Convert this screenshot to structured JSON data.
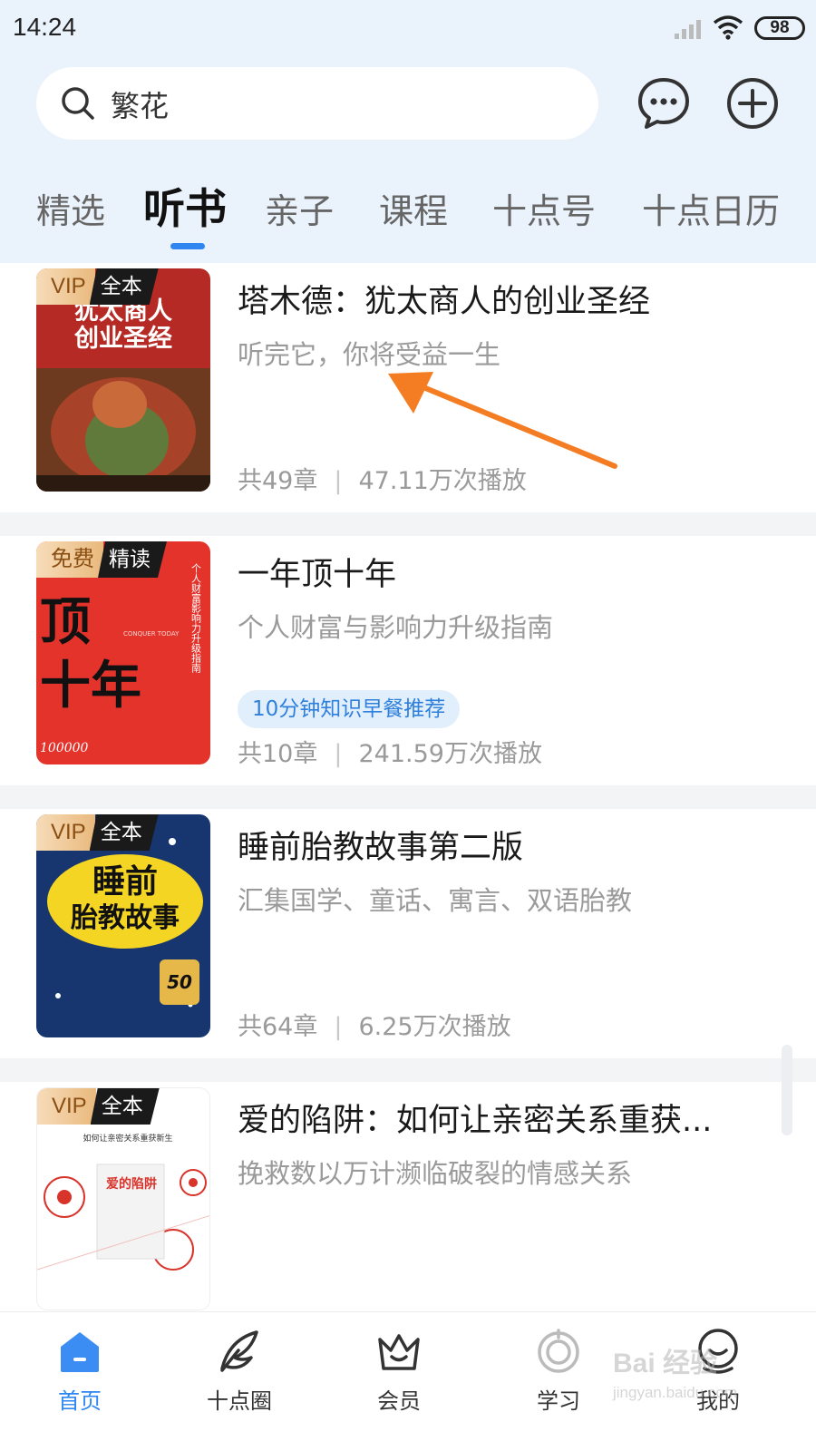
{
  "status_bar": {
    "time": "14:24",
    "battery": "98"
  },
  "search": {
    "value": "繁花"
  },
  "tabs": [
    {
      "label": "精选"
    },
    {
      "label": "听书"
    },
    {
      "label": "亲子"
    },
    {
      "label": "课程"
    },
    {
      "label": "十点号"
    },
    {
      "label": "十点日历"
    }
  ],
  "active_tab": "听书",
  "items": [
    {
      "title": "塔木德：犹太商人的创业圣经",
      "subtitle": "听完它，你将受益一生",
      "badge_left": "VIP",
      "badge_right": "全本",
      "chapters": "共49章",
      "plays": "47.11万次播放",
      "cover_text_1": "犹太商人",
      "cover_text_2": "创业圣经",
      "cover_colors": [
        "#c0302a",
        "#8a2a1f",
        "#d9a441"
      ]
    },
    {
      "title": "一年顶十年",
      "subtitle": "个人财富与影响力升级指南",
      "badge_left": "免费",
      "badge_right": "精读",
      "tag": "10分钟知识早餐推荐",
      "chapters": "共10章",
      "plays": "241.59万次播放",
      "cover_text_1": "顶",
      "cover_text_2": "十年",
      "cover_small_1": "个人财富影响力升级指南",
      "cover_small_2": "CONQUER TODAY",
      "cover_small_3": "100000",
      "cover_colors": [
        "#e4332b",
        "#111111"
      ]
    },
    {
      "title": "睡前胎教故事第二版",
      "subtitle": "汇集国学、童话、寓言、双语胎教",
      "badge_left": "VIP",
      "badge_right": "全本",
      "chapters": "共64章",
      "plays": "6.25万次播放",
      "cover_text_1": "睡前",
      "cover_text_2": "胎教故事",
      "cover_small_1": "50",
      "cover_colors": [
        "#17366f",
        "#f5d524"
      ]
    },
    {
      "title": "爱的陷阱：如何让亲密关系重获...",
      "subtitle": "挽救数以万计濒临破裂的情感关系",
      "badge_left": "VIP",
      "badge_right": "全本",
      "cover_text_1": "如何让亲密关系重获新生",
      "cover_text_2": "爱的陷阱",
      "cover_colors": [
        "#ffffff",
        "#d8342b"
      ]
    }
  ],
  "bottom_nav": [
    {
      "label": "首页",
      "icon": "home-icon",
      "active": true
    },
    {
      "label": "十点圈",
      "icon": "feather-icon",
      "active": false
    },
    {
      "label": "会员",
      "icon": "crown-icon",
      "active": false
    },
    {
      "label": "学习",
      "icon": "study-icon",
      "active": false
    },
    {
      "label": "我的",
      "icon": "profile-icon",
      "active": false
    }
  ],
  "watermark": {
    "line1": "Bai 经验",
    "line2": "jingyan.baidu.com"
  },
  "colors": {
    "accent": "#2f86f1",
    "arrow": "#f47c22",
    "header_bg": "#eaf2fc"
  }
}
